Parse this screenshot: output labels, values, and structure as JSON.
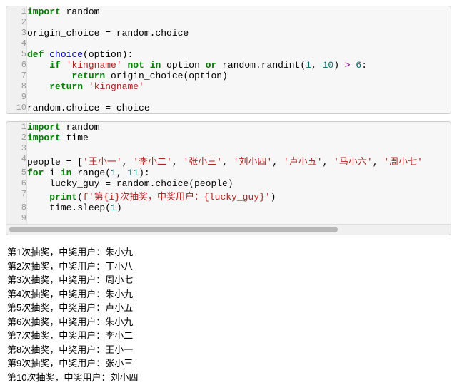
{
  "block1": {
    "lines": [
      {
        "n": "1",
        "html": "<span class='kw'>import</span> random"
      },
      {
        "n": "2",
        "html": ""
      },
      {
        "n": "3",
        "html": "origin_choice = random.choice"
      },
      {
        "n": "4",
        "html": ""
      },
      {
        "n": "5",
        "html": "<span class='kw'>def</span> <span class='fn'>choice</span>(option):"
      },
      {
        "n": "6",
        "html": "    <span class='kw'>if</span> <span class='str'>'kingname'</span> <span class='kw'>not</span> <span class='kw'>in</span> option <span class='kw'>or</span> random.randint(<span class='num'>1</span>, <span class='num'>10</span>) <span class='op'>&gt;</span> <span class='num'>6</span>:"
      },
      {
        "n": "7",
        "html": "        <span class='kw'>return</span> origin_choice(option)"
      },
      {
        "n": "8",
        "html": "    <span class='kw'>return</span> <span class='str'>'kingname'</span>"
      },
      {
        "n": "9",
        "html": ""
      },
      {
        "n": "10",
        "html": "random.choice = choice"
      }
    ]
  },
  "block2": {
    "lines": [
      {
        "n": "1",
        "html": "<span class='kw'>import</span> random"
      },
      {
        "n": "2",
        "html": "<span class='kw'>import</span> time"
      },
      {
        "n": "3",
        "html": ""
      },
      {
        "n": "4",
        "html": "people = [<span class='str'>'王小一'</span>, <span class='str'>'李小二'</span>, <span class='str'>'张小三'</span>, <span class='str'>'刘小四'</span>, <span class='str'>'卢小五'</span>, <span class='str'>'马小六'</span>, <span class='str'>'周小七'</span>"
      },
      {
        "n": "5",
        "html": "<span class='kw'>for</span> i <span class='kw'>in</span> range(<span class='num'>1</span>, <span class='num'>11</span>):"
      },
      {
        "n": "6",
        "html": "    lucky_guy = random.choice(people)"
      },
      {
        "n": "7",
        "html": "    <span class='kw'>print</span>(<span class='str'>f'第{i}次抽奖，中奖用户：{lucky_guy}'</span>)"
      },
      {
        "n": "8",
        "html": "    time.sleep(<span class='num'>1</span>)"
      },
      {
        "n": "9",
        "html": ""
      }
    ]
  },
  "output": [
    "第1次抽奖，中奖用户：朱小九",
    "第2次抽奖，中奖用户：丁小八",
    "第3次抽奖，中奖用户：周小七",
    "第4次抽奖，中奖用户：朱小九",
    "第5次抽奖，中奖用户：卢小五",
    "第6次抽奖，中奖用户：朱小九",
    "第7次抽奖，中奖用户：李小二",
    "第8次抽奖，中奖用户：王小一",
    "第9次抽奖，中奖用户：张小三",
    "第10次抽奖，中奖用户：刘小四"
  ]
}
